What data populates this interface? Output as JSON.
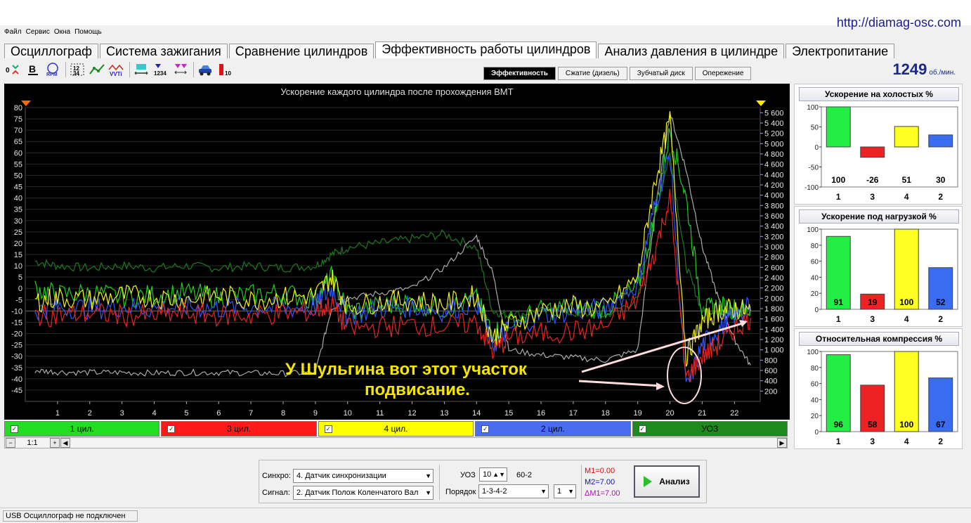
{
  "url": "http://diamag-osc.com",
  "menu": [
    "Файл",
    "Сервис",
    "Окна",
    "Помощь"
  ],
  "tabs": [
    "Осциллограф",
    "Система зажигания",
    "Сравнение цилиндров",
    "Эффективность работы цилиндров",
    "Анализ давления в цилиндре",
    "Электропитание"
  ],
  "active_tab": "Эффективность работы цилиндров",
  "subtabs": [
    "Эффективность",
    "Сжатие (дизель)",
    "Зубчатый диск",
    "Опережение"
  ],
  "active_subtab": "Эффективность",
  "rpm": {
    "value": "1249",
    "unit": "об./мин."
  },
  "chart_data": {
    "type": "line",
    "title": "Ускорение каждого цилиндра после прохождения ВМТ",
    "y_left_ticks": [
      "80",
      "75",
      "70",
      "65",
      "60",
      "55",
      "50",
      "45",
      "40",
      "35",
      "30",
      "25",
      "20",
      "15",
      "10",
      "5",
      "0",
      "-5",
      "-10",
      "-15",
      "-20",
      "-25",
      "-30",
      "-35",
      "-40",
      "-45"
    ],
    "y_right_ticks": [
      "5 600",
      "5 400",
      "5 200",
      "5 000",
      "4 800",
      "4 600",
      "4 400",
      "4 200",
      "4 000",
      "3 800",
      "3 600",
      "3 400",
      "3 200",
      "3 000",
      "2 800",
      "2 600",
      "2 400",
      "2 200",
      "2 000",
      "1 800",
      "1 600",
      "1 400",
      "1 200",
      "1 000",
      "800",
      "600",
      "400",
      "200"
    ],
    "x_ticks": [
      "1",
      "2",
      "3",
      "4",
      "5",
      "6",
      "7",
      "8",
      "9",
      "10",
      "11",
      "12",
      "13",
      "14",
      "15",
      "16",
      "17",
      "18",
      "19",
      "20",
      "21",
      "22"
    ],
    "ylim": [
      -50,
      80
    ],
    "y2lim": [
      0,
      5700
    ],
    "xlim": [
      0,
      22.8
    ],
    "series": [
      {
        "name": "1 цил.",
        "color": "#22cc22",
        "x": [
          0.3,
          1,
          2,
          3,
          4,
          5,
          6,
          7,
          8,
          9,
          9.5,
          10,
          11,
          12,
          13,
          14,
          14.5,
          15,
          16,
          17,
          18,
          19,
          19.5,
          20,
          20.5,
          21,
          21.5,
          22,
          22.5
        ],
        "values": [
          0,
          -3,
          -2,
          -4,
          -3,
          -2,
          -4,
          -3,
          -2,
          -5,
          5,
          -10,
          -8,
          -6,
          -9,
          -5,
          -20,
          -15,
          -10,
          -8,
          -9,
          0,
          30,
          70,
          40,
          -10,
          -8,
          -9,
          -10
        ]
      },
      {
        "name": "3 цил.",
        "color": "#ee2222",
        "x": [
          0.3,
          1,
          2,
          3,
          4,
          5,
          6,
          7,
          8,
          9,
          9.5,
          10,
          11,
          12,
          13,
          14,
          14.5,
          15,
          16,
          17,
          18,
          19,
          19.5,
          20,
          20.5,
          21,
          21.5,
          22,
          22.5
        ],
        "values": [
          -12,
          -12,
          -11,
          -12,
          -12,
          -11,
          -12,
          -12,
          -11,
          -10,
          -7,
          -18,
          -17,
          -16,
          -17,
          -15,
          -28,
          -22,
          -20,
          -19,
          -17,
          -5,
          15,
          40,
          -40,
          -30,
          -25,
          -18,
          -13
        ]
      },
      {
        "name": "4 цил.",
        "color": "#f0f020",
        "x": [
          0.3,
          1,
          2,
          3,
          4,
          5,
          6,
          7,
          8,
          9,
          9.5,
          10,
          11,
          12,
          13,
          14,
          14.5,
          15,
          16,
          17,
          18,
          19,
          19.5,
          20,
          20.5,
          21,
          21.5,
          22,
          22.5
        ],
        "values": [
          -6,
          -4,
          -5,
          -3,
          -4,
          -5,
          -3,
          -5,
          -4,
          -3,
          5,
          -8,
          -6,
          -5,
          -7,
          -3,
          -22,
          -16,
          -10,
          -8,
          -9,
          5,
          45,
          75,
          -30,
          -15,
          -10,
          -9,
          -10
        ]
      },
      {
        "name": "2 цил.",
        "color": "#3355ff",
        "x": [
          0.3,
          1,
          2,
          3,
          4,
          5,
          6,
          7,
          8,
          9,
          9.5,
          10,
          11,
          12,
          13,
          14,
          14.5,
          15,
          16,
          17,
          18,
          19,
          19.5,
          20,
          20.5,
          21,
          21.5,
          22,
          22.5
        ],
        "values": [
          -10,
          -8,
          -9,
          -8,
          -9,
          -8,
          -9,
          -8,
          -9,
          -8,
          0,
          -12,
          -9,
          -8,
          -10,
          -6,
          -25,
          -18,
          -12,
          -10,
          -9,
          2,
          35,
          60,
          -45,
          -25,
          -18,
          -12,
          -8
        ]
      },
      {
        "name": "УОЗ",
        "color": "#1f7a1f",
        "x": [
          0.3,
          1,
          2,
          3,
          4,
          5,
          6,
          7,
          8,
          9,
          9.5,
          10,
          11,
          12,
          13,
          14,
          14.5,
          15,
          16,
          17,
          18,
          19,
          19.5,
          20,
          20.5,
          21,
          21.5,
          22,
          22.5
        ],
        "values": [
          12,
          10,
          9,
          10,
          9,
          10,
          9,
          10,
          9,
          10,
          15,
          18,
          20,
          22,
          24,
          18,
          -10,
          -12,
          -10,
          -11,
          -12,
          -5,
          30,
          60,
          10,
          -10,
          -10,
          -10,
          -12
        ]
      },
      {
        "name": "обороты",
        "color": "#aaaaaa",
        "axis": "right",
        "x": [
          0.3,
          1,
          2,
          3,
          4,
          5,
          6,
          7,
          8,
          9,
          9.5,
          10,
          11,
          12,
          13,
          14,
          14.5,
          15,
          16,
          17,
          18,
          19,
          19.5,
          20,
          20.5,
          21,
          21.5,
          22,
          22.5
        ],
        "values": [
          600,
          570,
          560,
          560,
          550,
          560,
          560,
          550,
          540,
          560,
          1800,
          2000,
          2100,
          2200,
          2600,
          3200,
          2500,
          1000,
          900,
          850,
          800,
          1000,
          3500,
          5600,
          4500,
          3000,
          2000,
          1200,
          700
        ]
      }
    ]
  },
  "legend": [
    {
      "label": "1 цил.",
      "color": "#22dd22",
      "checked": "✓"
    },
    {
      "label": "3 цил.",
      "color": "#ff1a1a",
      "checked": "✓"
    },
    {
      "label": "4 цил.",
      "color": "#ffff00",
      "checked": "✓"
    },
    {
      "label": "2 цил.",
      "color": "#4a6cf0",
      "checked": "✓"
    },
    {
      "label": "УОЗ",
      "color": "#1e8a1e",
      "checked": "✓"
    }
  ],
  "zoom": "1:1",
  "annotation": [
    "У Шульгина вот этот участок",
    "подвисание."
  ],
  "panels": [
    {
      "title": "Ускорение на холостых %",
      "ticks": [
        "100",
        "50",
        "0",
        "-50",
        "-100"
      ],
      "ylim": [
        -100,
        100
      ],
      "bars": [
        {
          "cyl": "1",
          "value": 100,
          "color": "#22ee44"
        },
        {
          "cyl": "3",
          "value": -26,
          "color": "#ee2222"
        },
        {
          "cyl": "4",
          "value": 51,
          "color": "#ffff22"
        },
        {
          "cyl": "2",
          "value": 30,
          "color": "#3a6cf0"
        }
      ]
    },
    {
      "title": "Ускорение под нагрузкой %",
      "ticks": [
        "100",
        "80",
        "60",
        "40",
        "20",
        "0"
      ],
      "ylim": [
        0,
        100
      ],
      "bars": [
        {
          "cyl": "1",
          "value": 91,
          "color": "#22ee44"
        },
        {
          "cyl": "3",
          "value": 19,
          "color": "#ee2222"
        },
        {
          "cyl": "4",
          "value": 100,
          "color": "#ffff22"
        },
        {
          "cyl": "2",
          "value": 52,
          "color": "#3a6cf0"
        }
      ]
    },
    {
      "title": "Относительная компрессия %",
      "ticks": [
        "100",
        "80",
        "60",
        "40",
        "20",
        "0"
      ],
      "ylim": [
        0,
        100
      ],
      "bars": [
        {
          "cyl": "1",
          "value": 96,
          "color": "#22ee44"
        },
        {
          "cyl": "3",
          "value": 58,
          "color": "#ee2222"
        },
        {
          "cyl": "4",
          "value": 100,
          "color": "#ffff22"
        },
        {
          "cyl": "2",
          "value": 67,
          "color": "#3a6cf0"
        }
      ]
    }
  ],
  "controls": {
    "sync_label": "Синхро:",
    "sync_value": "4.  Датчик синхронизации",
    "signal_label": "Сигнал:",
    "signal_value": "2.  Датчик Полож Коленчатого Вал",
    "uoz_label": "УОЗ",
    "uoz_value": "10",
    "teeth": "60-2",
    "order_label": "Порядок",
    "order_value": "1-3-4-2",
    "order_num": "1",
    "m1": "M1=0.00",
    "m2": "M2=7.00",
    "dm": "ΔM1=7.00",
    "analyze": "Анализ"
  },
  "status": "USB Осциллограф не подключен"
}
